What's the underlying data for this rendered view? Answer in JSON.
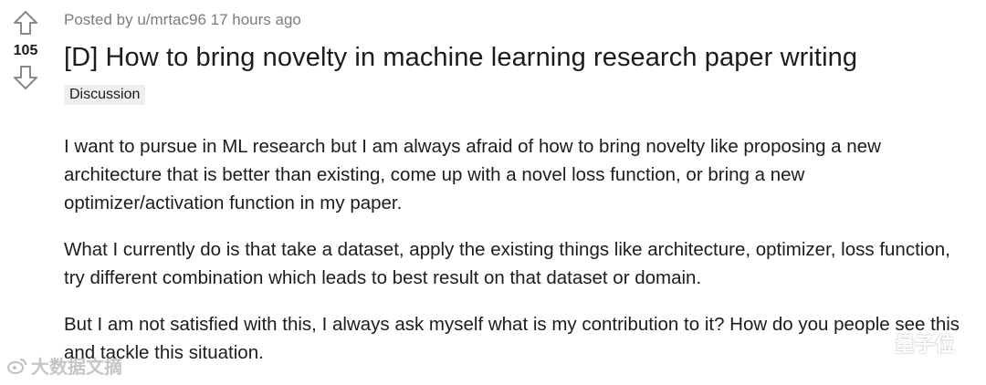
{
  "vote": {
    "count": "105",
    "upvote_icon": "arrow-up-outline-icon",
    "downvote_icon": "arrow-down-outline-icon"
  },
  "post": {
    "meta": "Posted by u/mrtac96 17 hours ago",
    "title": "[D] How to bring novelty in machine learning research paper writing",
    "flair": "Discussion",
    "paragraphs": [
      "I want to pursue in ML research but I am always afraid of how to bring novelty like proposing a new architecture that is better than existing, come up with a novel loss function, or bring a new optimizer/activation function in my paper.",
      "What I currently do is that take a dataset, apply the existing things like architecture, optimizer, loss function, try different combination which leads to best result on that dataset or domain.",
      "But I am not satisfied with this, I always ask myself what is my contribution to it? How do you people see this and tackle this situation."
    ]
  },
  "watermarks": {
    "left_text": "大数据文摘",
    "right_text": "量子位"
  },
  "colors": {
    "meta": "#7c7c7c",
    "text": "#1c1c1c",
    "flair_bg": "#edeff1",
    "arrow": "#878a8c"
  }
}
